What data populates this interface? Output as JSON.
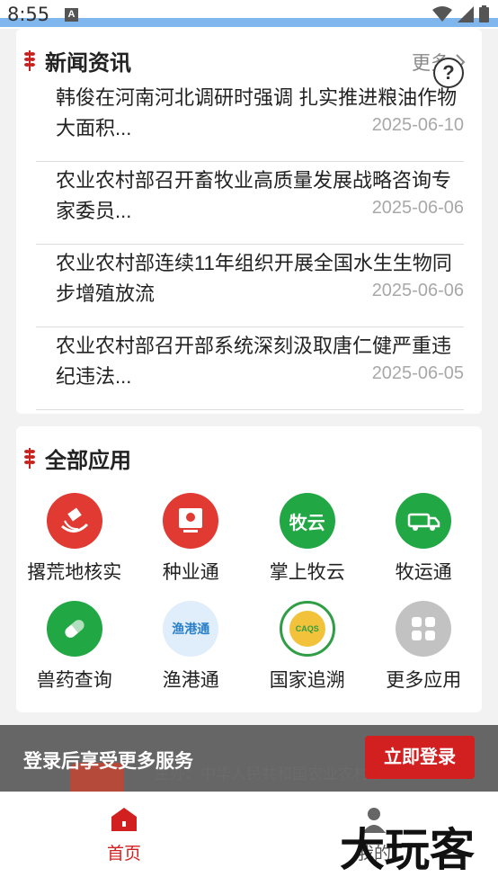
{
  "status_bar": {
    "time": "8:55",
    "notification_icon": "a-icon",
    "icons": [
      "wifi-icon",
      "signal-icon",
      "battery-icon"
    ]
  },
  "news": {
    "title": "新闻资讯",
    "more_label": "更多",
    "items": [
      {
        "headline": "韩俊在河南河北调研时强调 扎实推进粮油作物大面积...",
        "date": "2025-06-10"
      },
      {
        "headline": "农业农村部召开畜牧业高质量发展战略咨询专家委员...",
        "date": "2025-06-06"
      },
      {
        "headline": "农业农村部连续11年组织开展全国水生生物同步增殖放流",
        "date": "2025-06-06"
      },
      {
        "headline": "农业农村部召开部系统深刻汲取唐仁健严重违纪违法...",
        "date": "2025-06-05"
      }
    ]
  },
  "apps": {
    "title": "全部应用",
    "items": [
      {
        "label": "撂荒地核实",
        "icon": "satellite-icon",
        "color": "#e03a32"
      },
      {
        "label": "种业通",
        "icon": "seed-screen-icon",
        "color": "#e03a32"
      },
      {
        "label": "掌上牧云",
        "icon": "muyun-icon",
        "color": "#22a745",
        "icon_text": "牧云"
      },
      {
        "label": "牧运通",
        "icon": "truck-icon",
        "color": "#22a745"
      },
      {
        "label": "兽药查询",
        "icon": "pill-icon",
        "color": "#22a745"
      },
      {
        "label": "渔港通",
        "icon": "fishing-port-icon",
        "color": "#2a7fc9",
        "icon_text": "渔港通"
      },
      {
        "label": "国家追溯",
        "icon": "trace-emblem-icon",
        "color": "#2f9e44",
        "icon_text": "CAQS"
      },
      {
        "label": "更多应用",
        "icon": "grid-icon",
        "color": "#c2c2c2"
      }
    ]
  },
  "footer": {
    "sponsor_text": "主办：中华人民共和国农业农村部"
  },
  "login_banner": {
    "text": "登录后享受更多服务",
    "button_label": "立即登录"
  },
  "tabbar": {
    "home_label": "首页",
    "mine_label": "我的"
  },
  "watermark": {
    "text": "大玩客"
  },
  "colors": {
    "accent": "#d21f1f",
    "green": "#22a745",
    "status_blue": "#7fb6ee"
  }
}
